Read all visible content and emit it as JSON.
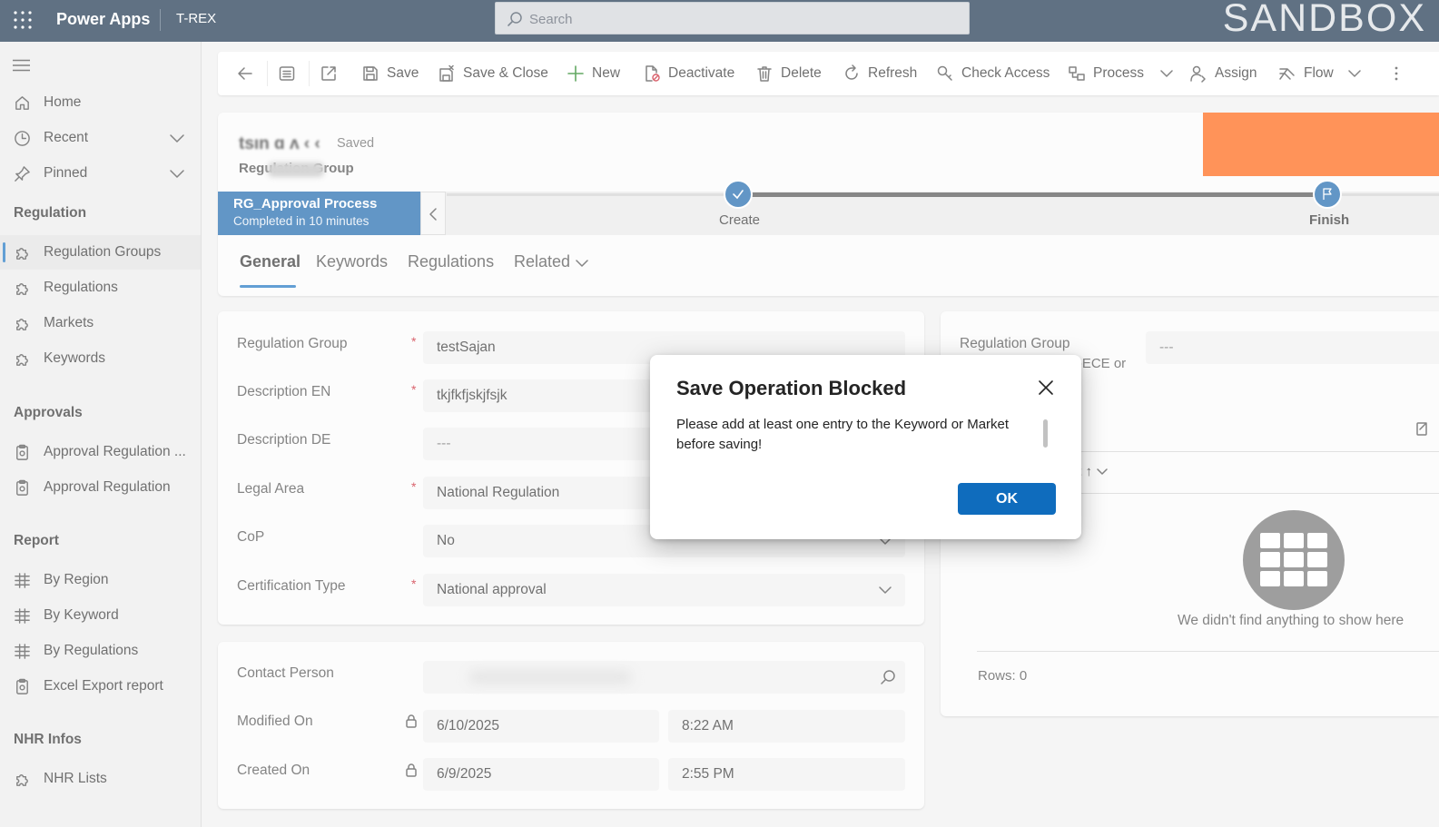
{
  "topbar": {
    "app_name": "Power Apps",
    "environment": "T-REX",
    "search_placeholder": "Search",
    "sandbox_label": "SANDBOX",
    "background_color": "#0b2641"
  },
  "sidebar": {
    "top_items": [
      {
        "label": "Home",
        "icon": "home-icon"
      },
      {
        "label": "Recent",
        "icon": "clock-icon",
        "expandable": true
      },
      {
        "label": "Pinned",
        "icon": "pin-icon",
        "expandable": true
      }
    ],
    "sections": [
      {
        "title": "Regulation",
        "items": [
          {
            "label": "Regulation Groups",
            "icon": "puzzle-icon",
            "active": true
          },
          {
            "label": "Regulations",
            "icon": "puzzle-icon"
          },
          {
            "label": "Markets",
            "icon": "puzzle-icon"
          },
          {
            "label": "Keywords",
            "icon": "puzzle-icon"
          }
        ]
      },
      {
        "title": "Approvals",
        "items": [
          {
            "label": "Approval Regulation ...",
            "icon": "clipboard-icon"
          },
          {
            "label": "Approval Regulation",
            "icon": "clipboard-icon"
          }
        ]
      },
      {
        "title": "Report",
        "items": [
          {
            "label": "By Region",
            "icon": "report-icon"
          },
          {
            "label": "By Keyword",
            "icon": "report-icon"
          },
          {
            "label": "By Regulations",
            "icon": "report-icon"
          },
          {
            "label": "Excel Export report",
            "icon": "clipboard-icon"
          }
        ]
      },
      {
        "title": "NHR Infos",
        "items": [
          {
            "label": "NHR Lists",
            "icon": "puzzle-icon"
          }
        ]
      }
    ]
  },
  "commandbar": {
    "save": "Save",
    "save_close": "Save & Close",
    "new": "New",
    "deactivate": "Deactivate",
    "delete": "Delete",
    "refresh": "Refresh",
    "check_access": "Check Access",
    "process": "Process",
    "assign": "Assign",
    "flow": "Flow"
  },
  "record": {
    "title": "tsın ɑ ʌ ‹ ‹",
    "status": "Saved",
    "entity": "Regulation Group",
    "redacted_color": "#ff5a00"
  },
  "bpf": {
    "name": "RG_Approval Process",
    "status": "Completed in 10 minutes",
    "stages": [
      "Create",
      "Finish"
    ]
  },
  "tabs": [
    "General",
    "Keywords",
    "Regulations",
    "Related"
  ],
  "general_section": {
    "fields": [
      {
        "label": "Regulation Group",
        "value": "testSajan",
        "required": true
      },
      {
        "label": "Description EN",
        "value": "tkjfkfjskjfsjk",
        "required": true
      },
      {
        "label": "Description DE",
        "value": "---",
        "required": false
      },
      {
        "label": "Legal Area",
        "value": "National Regulation",
        "required": true
      },
      {
        "label": "CoP",
        "value": "No",
        "required": false
      },
      {
        "label": "Certification Type",
        "value": "National approval",
        "required": true
      }
    ]
  },
  "contact_section": {
    "contact_label": "Contact Person",
    "contact_value": "",
    "modified_label": "Modified On",
    "modified_date": "6/10/2025",
    "modified_time": "8:22 AM",
    "created_label": "Created On",
    "created_date": "6/9/2025",
    "created_time": "2:55 PM"
  },
  "right_panel": {
    "field_label": "Regulation Group",
    "field_value": "---",
    "partial_text": "N-ECE or",
    "sort_fragment": "et ↑",
    "empty_message": "We didn't find anything to show here",
    "rows_label": "Rows: 0"
  },
  "dialog": {
    "title": "Save Operation Blocked",
    "message": "Please add at least one entry to the Keyword or Market before saving!",
    "ok_label": "OK",
    "accent": "#0f6cbd"
  }
}
